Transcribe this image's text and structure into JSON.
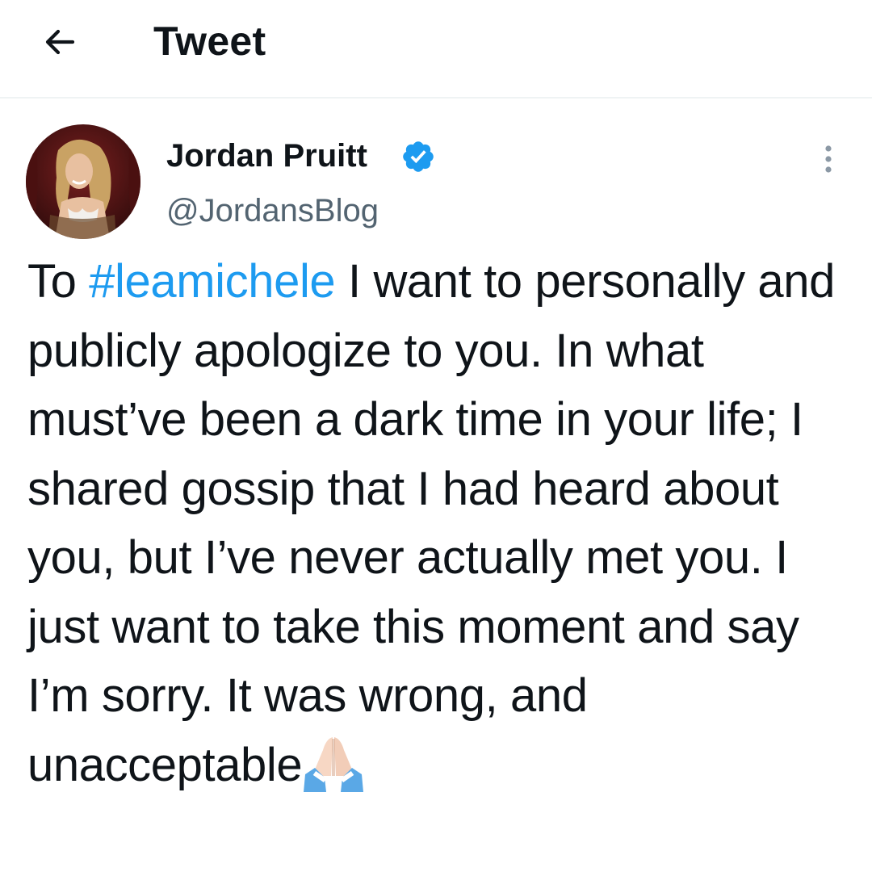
{
  "header": {
    "title": "Tweet",
    "back_icon": "arrow-left-icon"
  },
  "author": {
    "name": "Jordan Pruitt",
    "handle": "@JordansBlog",
    "verified": true,
    "verified_icon": "verified-badge-icon",
    "avatar_icon": "profile-avatar"
  },
  "more_icon": "more-vertical-icon",
  "tweet": {
    "prefix": "To ",
    "hashtag": "#leamichele",
    "body": " I want to personally and publicly apologize to you. In what must’ve been a dark time in your life; I shared gossip that I had heard about you, but I’ve never actually met you. I just want to take this moment and say I’m sorry. It was wrong, and unacceptable",
    "emoji_icon": "folded-hands-emoji"
  },
  "colors": {
    "link": "#1d9bf0",
    "text": "#0f1419",
    "secondary": "#536471",
    "verified": "#1d9bf0",
    "divider": "#eff3f4"
  }
}
